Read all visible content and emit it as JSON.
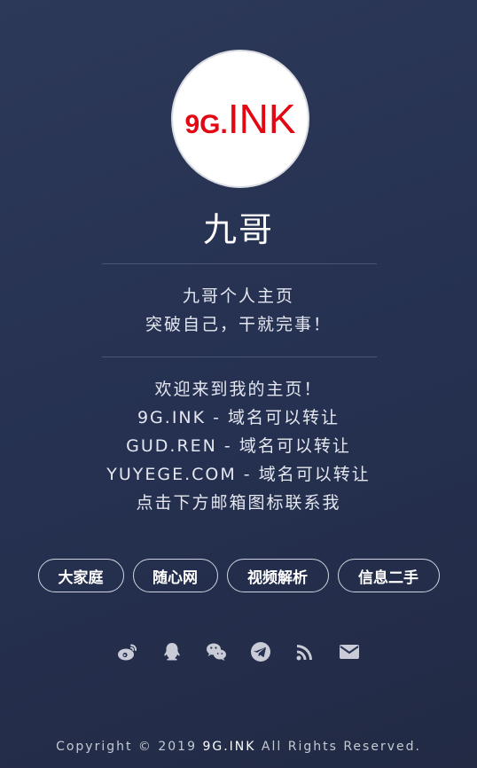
{
  "logo": {
    "small": "9G.",
    "big": "INK"
  },
  "profile": {
    "name": "九哥"
  },
  "bio": {
    "line1": "九哥个人主页",
    "line2": "突破自己，干就完事！"
  },
  "intro": {
    "line1": "欢迎来到我的主页！",
    "line2": "9G.INK - 域名可以转让",
    "line3": "GUD.REN - 域名可以转让",
    "line4": "YUYEGE.COM - 域名可以转让",
    "line5": "点击下方邮箱图标联系我"
  },
  "links": [
    {
      "label": "大家庭"
    },
    {
      "label": "随心网"
    },
    {
      "label": "视频解析"
    },
    {
      "label": "信息二手"
    }
  ],
  "social_icons": [
    "weibo-icon",
    "qq-icon",
    "wechat-icon",
    "telegram-icon",
    "rss-icon",
    "email-icon"
  ],
  "footer": {
    "prefix": "Copyright © 2019",
    "brand": "9G.INK",
    "suffix": "All Rights Reserved."
  }
}
